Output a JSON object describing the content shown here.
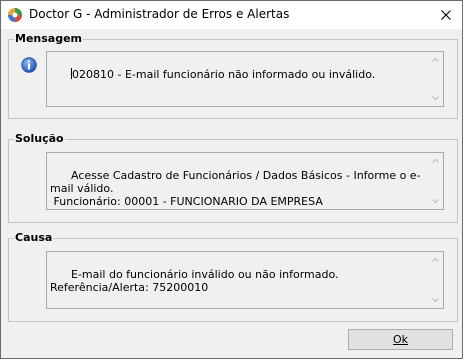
{
  "window": {
    "title": "Doctor G - Administrador de Erros e Alertas"
  },
  "mensagem": {
    "label": "Mensagem",
    "text": "020810 - E-mail funcionário não informado ou inválido."
  },
  "solucao": {
    "label": "Solução",
    "text": "Acesse Cadastro de Funcionários / Dados Básicos - Informe o e-mail válido.\n Funcionário: 00001 - FUNCIONARIO DA EMPRESA"
  },
  "causa": {
    "label": "Causa",
    "text": "E-mail do funcionário inválido ou não informado.\nReferência/Alerta: 75200010"
  },
  "buttons": {
    "ok": "Ok"
  },
  "icons": {
    "app": "doctor-g-app-icon",
    "info": "info-icon",
    "close": "close-icon"
  }
}
